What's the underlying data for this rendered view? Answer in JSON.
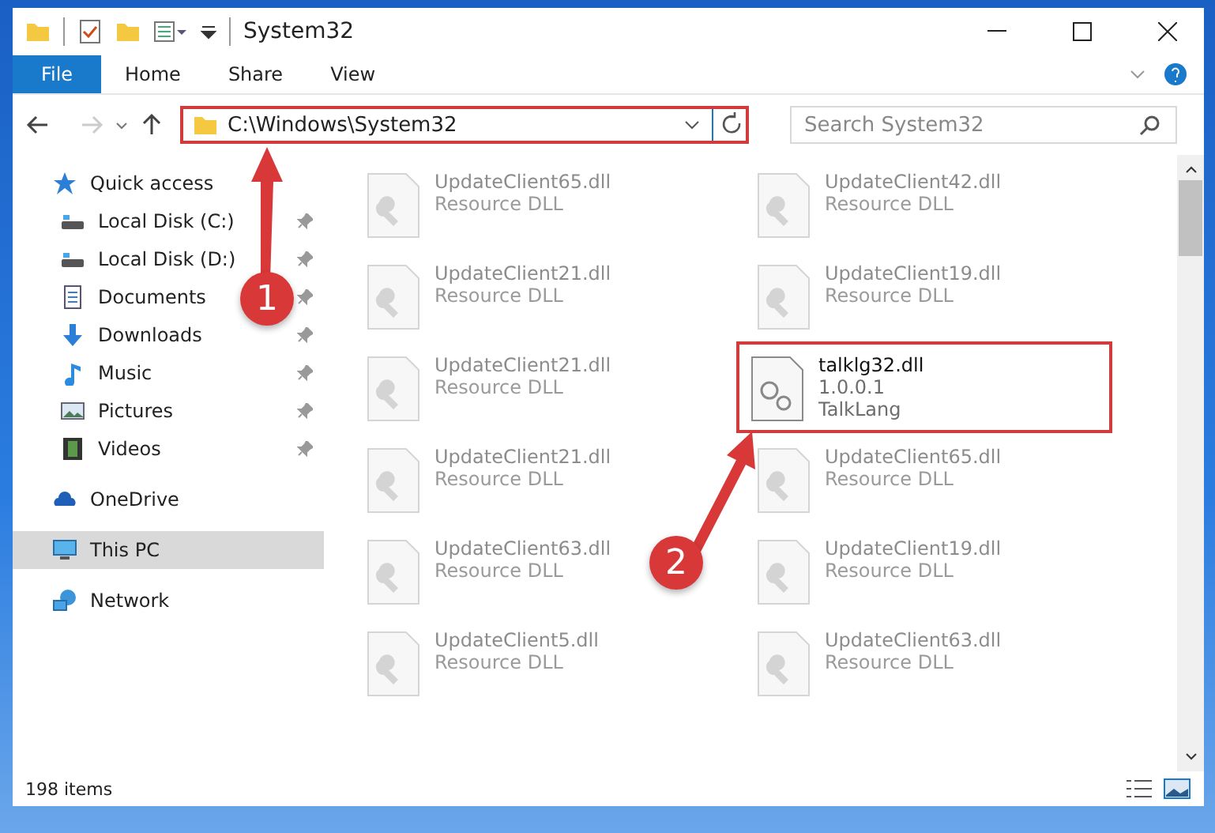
{
  "window": {
    "title": "System32"
  },
  "ribbon_tabs": [
    {
      "label": "File",
      "selected": true
    },
    {
      "label": "Home",
      "selected": false
    },
    {
      "label": "Share",
      "selected": false
    },
    {
      "label": "View",
      "selected": false
    }
  ],
  "address": {
    "path": "C:\\Windows\\System32",
    "highlighted": true
  },
  "search": {
    "placeholder": "Search System32"
  },
  "navigation": [
    {
      "label": "Quick access",
      "pinned": false,
      "selected": false,
      "children": [
        {
          "label": "Local Disk (C:)",
          "pinned": true,
          "selected": false
        },
        {
          "label": "Local Disk (D:)",
          "pinned": true,
          "selected": false
        },
        {
          "label": "Documents",
          "pinned": true,
          "selected": false
        },
        {
          "label": "Downloads",
          "pinned": true,
          "selected": false
        },
        {
          "label": "Music",
          "pinned": true,
          "selected": false
        },
        {
          "label": "Pictures",
          "pinned": true,
          "selected": false
        },
        {
          "label": "Videos",
          "pinned": true,
          "selected": false
        }
      ]
    },
    {
      "label": "OneDrive",
      "pinned": false,
      "selected": false
    },
    {
      "label": "This PC",
      "pinned": false,
      "selected": true
    },
    {
      "label": "Network",
      "pinned": false,
      "selected": false
    }
  ],
  "files": [
    {
      "name": "UpdateClient65.dll",
      "details": [
        "Resource DLL"
      ],
      "kind": "faded",
      "highlighted": false
    },
    {
      "name": "UpdateClient42.dll",
      "details": [
        "Resource DLL"
      ],
      "kind": "faded",
      "highlighted": false
    },
    {
      "name": "UpdateClient21.dll",
      "details": [
        "Resource DLL"
      ],
      "kind": "faded",
      "highlighted": false
    },
    {
      "name": "UpdateClient19.dll",
      "details": [
        "Resource DLL"
      ],
      "kind": "faded",
      "highlighted": false
    },
    {
      "name": "UpdateClient21.dll",
      "details": [
        "Resource DLL"
      ],
      "kind": "faded",
      "highlighted": false
    },
    {
      "name": "talklg32.dll",
      "details": [
        "1.0.0.1",
        "TalkLang"
      ],
      "kind": "normal",
      "highlighted": true
    },
    {
      "name": "UpdateClient21.dll",
      "details": [
        "Resource DLL"
      ],
      "kind": "faded",
      "highlighted": false
    },
    {
      "name": "UpdateClient65.dll",
      "details": [
        "Resource DLL"
      ],
      "kind": "faded",
      "highlighted": false
    },
    {
      "name": "UpdateClient63.dll",
      "details": [
        "Resource DLL"
      ],
      "kind": "faded",
      "highlighted": false
    },
    {
      "name": "UpdateClient19.dll",
      "details": [
        "Resource DLL"
      ],
      "kind": "faded",
      "highlighted": false
    },
    {
      "name": "UpdateClient5.dll",
      "details": [
        "Resource DLL"
      ],
      "kind": "faded",
      "highlighted": false
    },
    {
      "name": "UpdateClient63.dll",
      "details": [
        "Resource DLL"
      ],
      "kind": "faded",
      "highlighted": false
    }
  ],
  "status_bar": {
    "item_count": "198 items"
  },
  "callouts": [
    {
      "number": "1"
    },
    {
      "number": "2"
    }
  ]
}
